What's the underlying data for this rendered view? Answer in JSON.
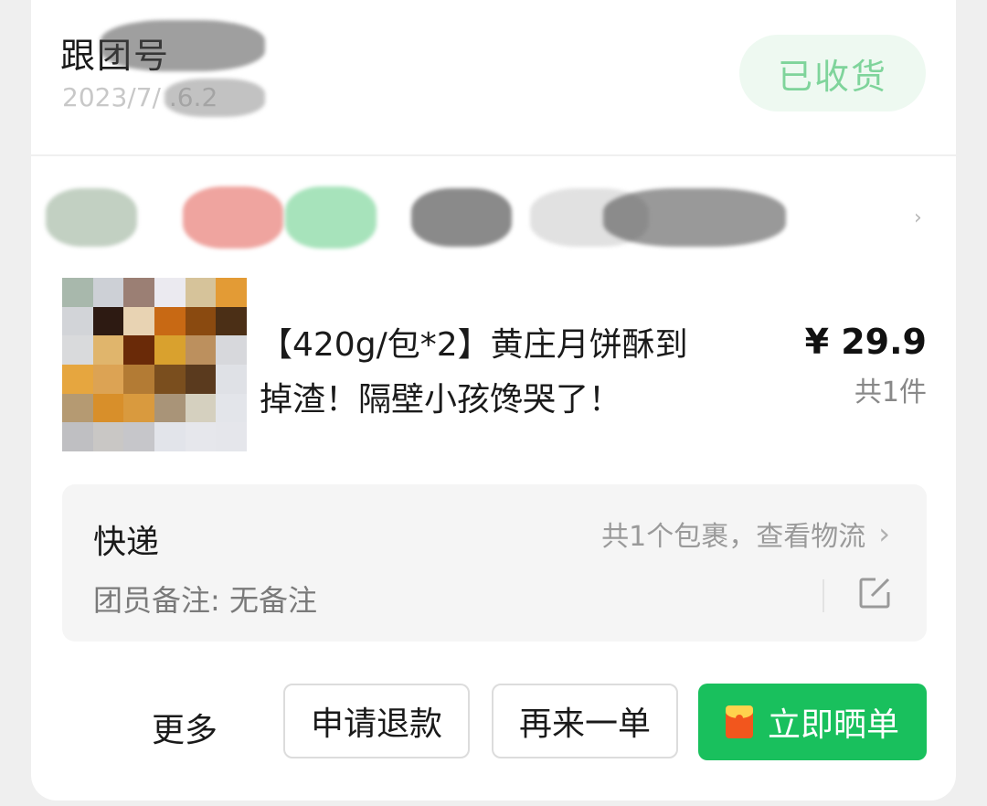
{
  "header": {
    "leader_name": "跟团号",
    "order_time": "2023/7/ .6.2",
    "status": "已收货"
  },
  "product": {
    "title": "【420g/包*2】黄庄月饼酥到掉渣！隔壁小孩馋哭了！",
    "price": "¥ 29.9",
    "quantity": "共1件"
  },
  "shipping": {
    "label": "快递",
    "link_text": "共1个包裹，查看物流",
    "remark": "团员备注: 无备注"
  },
  "actions": {
    "more": "更多",
    "refund": "申请退款",
    "reorder": "再来一单",
    "share": "立即晒单"
  },
  "colors": {
    "accent_green": "#19c05d",
    "badge_bg": "#eef9f1",
    "badge_text": "#7fd49b"
  }
}
